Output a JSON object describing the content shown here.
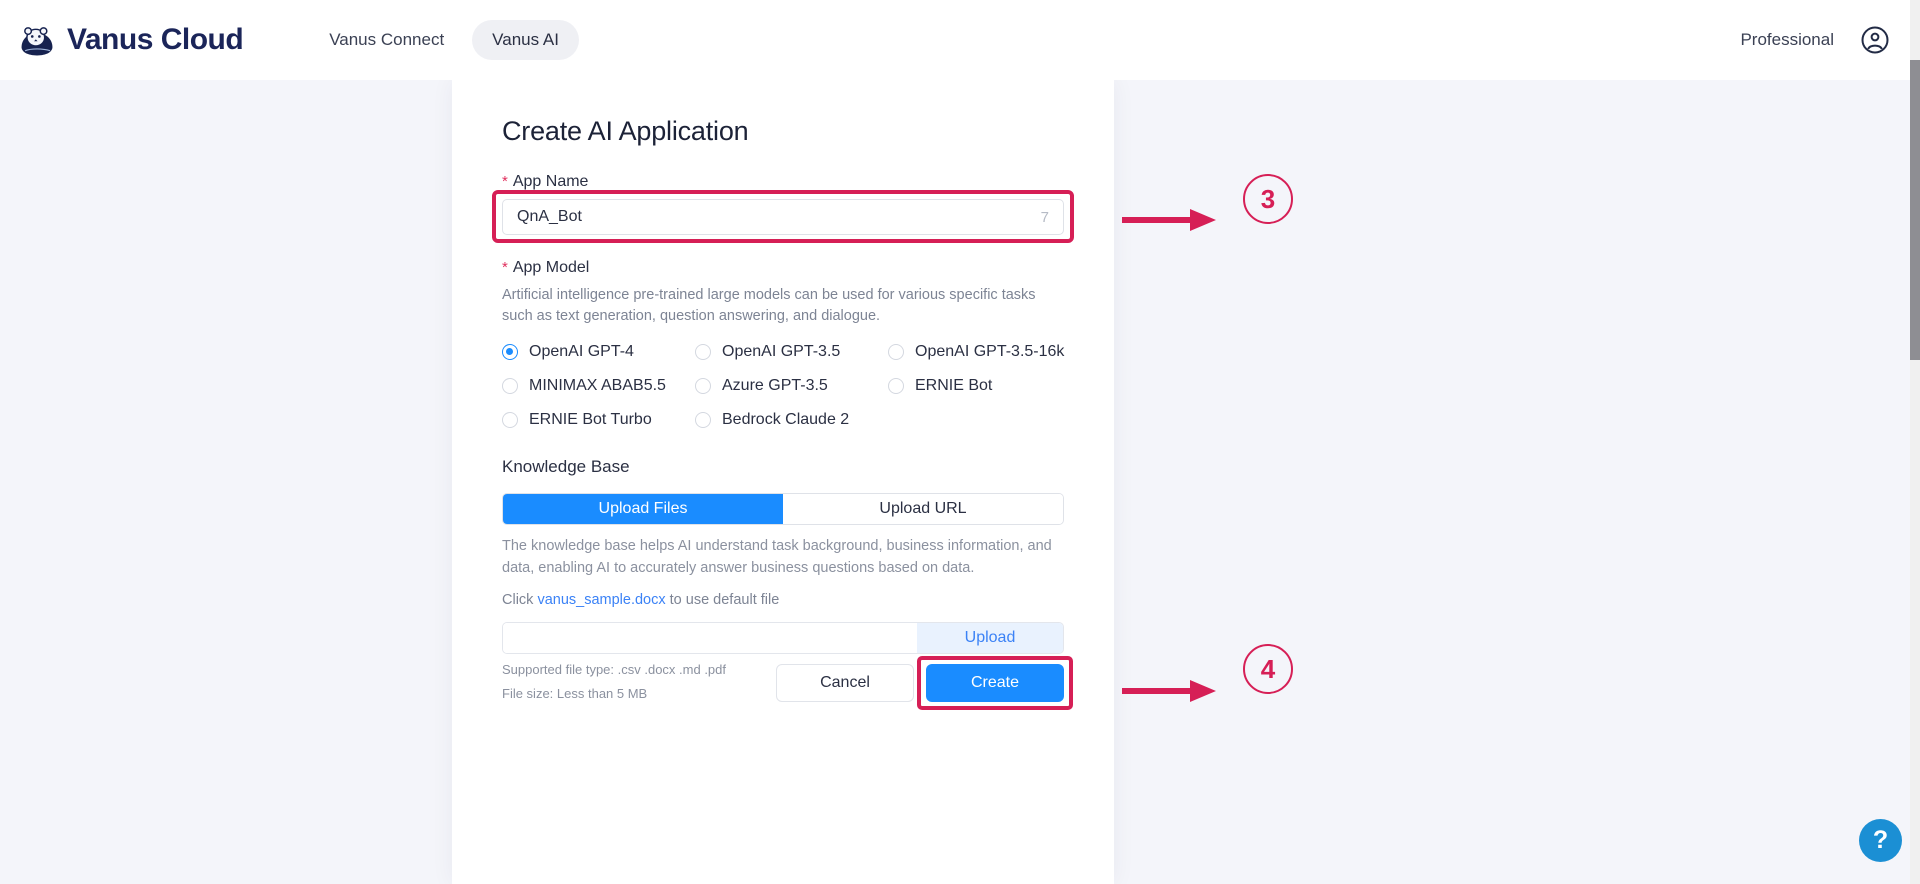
{
  "header": {
    "brand_name": "Vanus Cloud",
    "logo_icon": "vanus-otter-logo",
    "nav": [
      {
        "label": "Vanus Connect",
        "active": false
      },
      {
        "label": "Vanus AI",
        "active": true
      }
    ],
    "plan_label": "Professional",
    "account_icon": "user-circle-icon"
  },
  "form": {
    "title": "Create AI Application",
    "app_name": {
      "label": "App Name",
      "required_marker": "*",
      "value": "QnA_Bot",
      "char_count": "7"
    },
    "app_model": {
      "label": "App Model",
      "required_marker": "*",
      "description": "Artificial intelligence pre-trained large models can be used for various specific tasks such as text generation, question answering, and dialogue.",
      "options": [
        {
          "label": "OpenAI GPT-4",
          "selected": true
        },
        {
          "label": "OpenAI GPT-3.5",
          "selected": false
        },
        {
          "label": "OpenAI GPT-3.5-16k",
          "selected": false
        },
        {
          "label": "MINIMAX ABAB5.5",
          "selected": false
        },
        {
          "label": "Azure GPT-3.5",
          "selected": false
        },
        {
          "label": "ERNIE Bot",
          "selected": false
        },
        {
          "label": "ERNIE Bot Turbo",
          "selected": false
        },
        {
          "label": "Bedrock Claude 2",
          "selected": false
        }
      ]
    },
    "knowledge_base": {
      "label": "Knowledge Base",
      "tabs": [
        {
          "label": "Upload Files",
          "active": true
        },
        {
          "label": "Upload URL",
          "active": false
        }
      ],
      "description": "The knowledge base helps AI understand task background, business information, and data, enabling AI to accurately answer business questions based on data.",
      "click_prefix": "Click ",
      "sample_file": "vanus_sample.docx",
      "click_suffix": " to use default file",
      "upload_field_value": "",
      "upload_field_placeholder": "",
      "upload_button": "Upload",
      "supported_types": "Supported file type: .csv .docx .md .pdf",
      "file_size": "File size: Less than 5 MB"
    },
    "actions": {
      "cancel_label": "Cancel",
      "create_label": "Create"
    }
  },
  "annotations": {
    "step_3": "3",
    "step_4": "4",
    "highlight_color": "#d61f56",
    "accent_color": "#1a8cff"
  },
  "help": {
    "label": "?",
    "icon": "question-mark-icon"
  }
}
